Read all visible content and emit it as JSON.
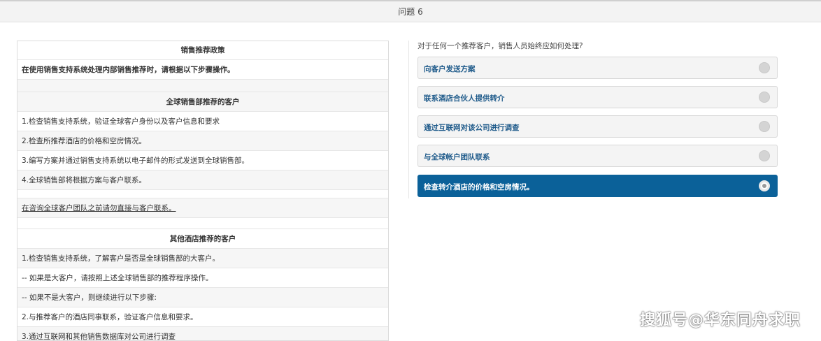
{
  "header": {
    "title": "问题 6"
  },
  "policy": {
    "rows": [
      {
        "text": "销售推荐政策",
        "style": "center",
        "h": 27
      },
      {
        "text": "在使用销售支持系统处理内部销售推荐时，请根据以下步骤操作。",
        "style": "bold",
        "h": 28
      },
      {
        "text": "",
        "style": "shaded",
        "h": 18
      },
      {
        "text": "全球销售部推荐的客户",
        "style": "center shaded",
        "h": 28
      },
      {
        "text": "1.检查销售支持系统，验证全球客户身份以及客户信息和要求",
        "style": "",
        "h": 28
      },
      {
        "text": "2.检查所推荐酒店的价格和空房情况。",
        "style": "shaded",
        "h": 28
      },
      {
        "text": "3.编写方案并通过销售支持系统以电子邮件的形式发送到全球销售部。",
        "style": "",
        "h": 28
      },
      {
        "text": "4.全球销售部将根据方案与客户联系。",
        "style": "shaded",
        "h": 28
      },
      {
        "text": "",
        "style": "",
        "h": 12
      },
      {
        "text": "在咨询全球客户团队之前请勿直接与客户联系。",
        "style": "underline shaded",
        "h": 28
      },
      {
        "text": "",
        "style": "",
        "h": 16
      },
      {
        "text": "其他酒店推荐的客户",
        "style": "center",
        "h": 28
      },
      {
        "text": "1.检查销售支持系统，了解客户是否是全球销售部的大客户。",
        "style": "shaded",
        "h": 28
      },
      {
        "text": "-- 如果是大客户，请按照上述全球销售部的推荐程序操作。",
        "style": "",
        "h": 28
      },
      {
        "text": "-- 如果不是大客户，则继续进行以下步骤:",
        "style": "shaded",
        "h": 28
      },
      {
        "text": "2.与推荐客户的酒店同事联系，验证客户信息和要求。",
        "style": "",
        "h": 28
      },
      {
        "text": "3.通过互联网和其他销售数据库对公司进行调查",
        "style": "shaded",
        "h": 28
      }
    ]
  },
  "question": {
    "prompt": "对于任何一个推荐客户，销售人员始终应如何处理?",
    "options": [
      {
        "label": "向客户发送方案",
        "selected": false
      },
      {
        "label": "联系酒店合伙人提供转介",
        "selected": false
      },
      {
        "label": "通过互联网对该公司进行调查",
        "selected": false
      },
      {
        "label": "与全球帐户团队联系",
        "selected": false
      },
      {
        "label": "检查转介酒店的价格和空房情况。",
        "selected": true
      }
    ]
  },
  "watermark": {
    "text": "搜狐号@华东同舟求职"
  },
  "colors": {
    "accent": "#0b6199",
    "option_text": "#1e5a8a"
  }
}
